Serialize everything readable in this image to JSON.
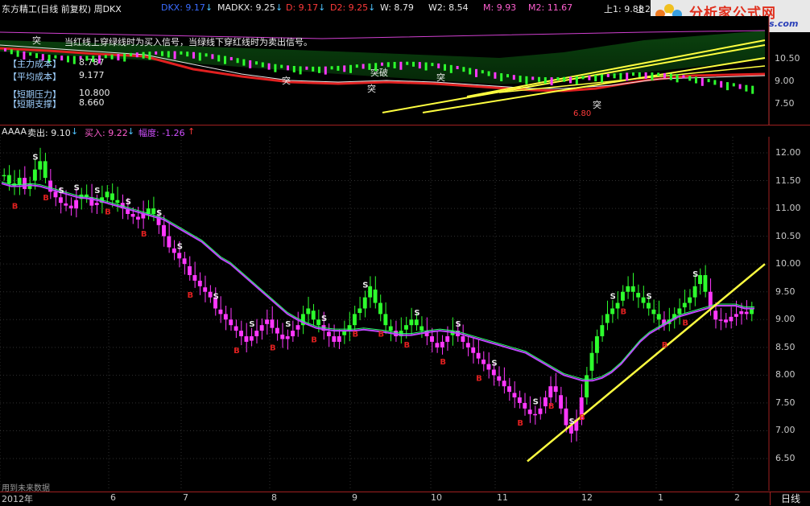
{
  "window": {
    "title": "东方精工(日线 前复权) 周DKX"
  },
  "top_indicators": [
    {
      "label": "DKX: 9.17",
      "color": "#3a6cff",
      "arrow": "↓"
    },
    {
      "label": "MADKX: 9.25",
      "color": "#e8e8e8",
      "arrow": "↓"
    },
    {
      "label": "D: 9.17",
      "color": "#ff3a3a",
      "arrow": "↓"
    },
    {
      "label": "D2: 9.25",
      "color": "#ff3a3a",
      "arrow": "↓"
    },
    {
      "label": "W: 8.79",
      "color": "#e8e8e8",
      "arrow": ""
    },
    {
      "label": "W2: 8.54",
      "color": "#e8e8e8",
      "arrow": ""
    },
    {
      "label": "M: 9.93",
      "color": "#ff5fd0",
      "arrow": ""
    },
    {
      "label": "M2: 11.67",
      "color": "#ff5fd0",
      "arrow": ""
    },
    {
      "label": "上1: 9.88",
      "color": "#e8e8e8",
      "arrow": ""
    },
    {
      "label": "上2: 9.",
      "color": "#e8e8e8",
      "arrow": ""
    }
  ],
  "logo": {
    "title": "分析家公式网",
    "url": "www.88gs.com"
  },
  "notes": [
    "当红线上穿绿线时为买入信号，",
    "当绿线下穿红线时为卖出信号。"
  ],
  "cost_panel": {
    "rows": [
      {
        "label": "【主力成本】",
        "value": "8.787"
      },
      {
        "label": "【平均成本】",
        "value": "9.177"
      },
      {
        "label": "【短期压力】",
        "value": "10.800"
      },
      {
        "label": "【短期支撑】",
        "value": "8.660"
      }
    ]
  },
  "upper_axis": {
    "ticks": [
      "10.50",
      "9.00",
      "7.50"
    ]
  },
  "upper_marks": [
    "突",
    "突",
    "突破",
    "突",
    "突",
    "突"
  ],
  "upper_price_tag": "6.80",
  "indicator_bar": {
    "name": "AAAA",
    "sell": "卖出: 9.10",
    "buy": "买入: 9.22",
    "amplitude": "幅度: -1.26"
  },
  "bottom_note": "用到未来数据",
  "period": "日线",
  "x_ticks": [
    "2012年",
    "6",
    "7",
    "8",
    "9",
    "10",
    "11",
    "12",
    "1",
    "2"
  ],
  "chart_data": {
    "type": "candlestick",
    "title": "AAAA",
    "y_axis": {
      "min": 6.5,
      "max": 12.0,
      "ticks": [
        "12.00",
        "11.50",
        "11.00",
        "10.50",
        "10.00",
        "9.50",
        "9.00",
        "8.50",
        "8.00",
        "7.50",
        "7.00",
        "6.50"
      ]
    },
    "series": [
      {
        "name": "close",
        "values": [
          11.6,
          11.45,
          11.4,
          11.55,
          11.35,
          11.45,
          11.7,
          11.85,
          11.55,
          11.3,
          11.2,
          11.1,
          11.05,
          11.0,
          11.15,
          11.25,
          11.2,
          11.05,
          11.1,
          11.2,
          11.3,
          11.15,
          11.1,
          11.0,
          10.9,
          10.85,
          10.8,
          10.9,
          11.0,
          10.9,
          10.7,
          10.5,
          10.3,
          10.2,
          10.1,
          10.0,
          9.8,
          9.7,
          9.6,
          9.5,
          9.4,
          9.2,
          9.1,
          9.0,
          8.9,
          8.8,
          8.7,
          8.6,
          8.7,
          8.8,
          8.9,
          9.0,
          8.85,
          8.75,
          8.65,
          8.7,
          8.8,
          8.9,
          9.1,
          9.2,
          9.0,
          8.9,
          8.8,
          8.7,
          8.6,
          8.7,
          8.8,
          8.9,
          9.1,
          9.2,
          9.4,
          9.6,
          9.3,
          9.1,
          8.9,
          8.8,
          8.7,
          8.8,
          8.9,
          9.0,
          8.9,
          8.8,
          8.7,
          8.6,
          8.5,
          8.6,
          8.7,
          8.8,
          8.7,
          8.6,
          8.5,
          8.4,
          8.3,
          8.2,
          8.1,
          8.0,
          7.9,
          7.8,
          7.7,
          7.6,
          7.5,
          7.4,
          7.3,
          7.3,
          7.4,
          7.6,
          7.8,
          7.7,
          7.4,
          7.1,
          6.95,
          7.2,
          7.6,
          8.0,
          8.4,
          8.7,
          8.9,
          9.1,
          9.2,
          9.3,
          9.5,
          9.6,
          9.5,
          9.4,
          9.3,
          9.2,
          9.1,
          9.0,
          8.9,
          9.0,
          9.1,
          9.2,
          9.3,
          9.4,
          9.6,
          9.8,
          9.5,
          9.2,
          9.0,
          9.0,
          8.95,
          9.05,
          9.1,
          9.15,
          9.1,
          9.2
        ]
      },
      {
        "name": "ma",
        "values": [
          11.45,
          11.4,
          11.4,
          11.42,
          11.4,
          11.35,
          11.3,
          11.25,
          11.2,
          11.18,
          11.15,
          11.1,
          11.05,
          11.0,
          10.95,
          10.9,
          10.85,
          10.8,
          10.7,
          10.6,
          10.5,
          10.4,
          10.25,
          10.1,
          10.0,
          9.85,
          9.7,
          9.55,
          9.4,
          9.25,
          9.1,
          9.0,
          8.92,
          8.85,
          8.82,
          8.8,
          8.8,
          8.8,
          8.82,
          8.8,
          8.78,
          8.75,
          8.72,
          8.72,
          8.75,
          8.78,
          8.8,
          8.78,
          8.75,
          8.7,
          8.65,
          8.6,
          8.55,
          8.5,
          8.45,
          8.4,
          8.3,
          8.2,
          8.1,
          8.0,
          7.95,
          7.9,
          7.9,
          7.95,
          8.05,
          8.2,
          8.4,
          8.6,
          8.75,
          8.85,
          8.95,
          9.05,
          9.1,
          9.15,
          9.2,
          9.25,
          9.25,
          9.25,
          9.2,
          9.2
        ]
      }
    ],
    "buy_signals": 24,
    "sell_signals": 20
  }
}
